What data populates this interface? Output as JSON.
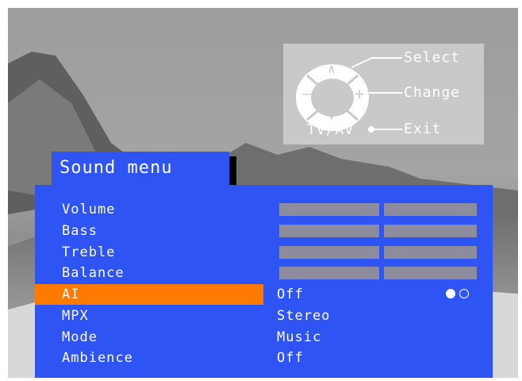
{
  "remote": {
    "select_label": "Select",
    "change_label": "Change",
    "exit_label": "Exit",
    "tvav_label": "TV/AV",
    "up_symbol": "∧",
    "down_symbol": "∨",
    "minus_symbol": "–",
    "plus_symbol": "+"
  },
  "menu": {
    "title": "Sound menu",
    "items": [
      {
        "label": "Volume",
        "control": "bar"
      },
      {
        "label": "Bass",
        "control": "bar"
      },
      {
        "label": "Treble",
        "control": "bar"
      },
      {
        "label": "Balance",
        "control": "bar"
      },
      {
        "label": "AI",
        "value": "Off",
        "selected": true
      },
      {
        "label": "MPX",
        "value": "Stereo"
      },
      {
        "label": "Mode",
        "value": "Music"
      },
      {
        "label": "Ambience",
        "value": "Off"
      }
    ]
  },
  "colors": {
    "menu_blue": "#2e54f4",
    "highlight_orange": "#ff7a00",
    "bar_gray": "#8c8c9e"
  }
}
